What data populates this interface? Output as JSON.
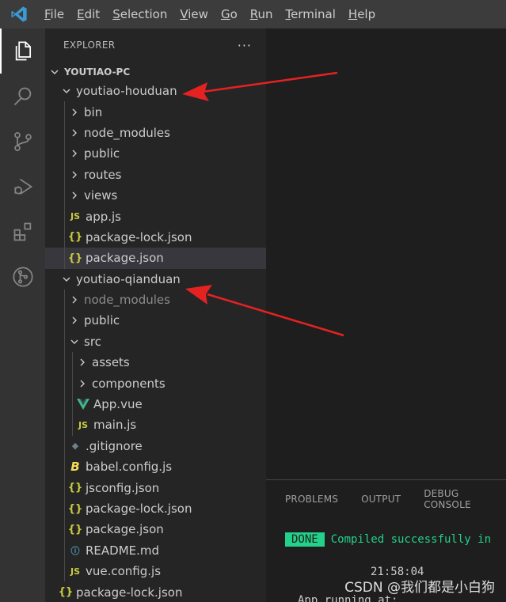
{
  "menu": {
    "items": [
      {
        "label_u": "F",
        "label_rest": "ile"
      },
      {
        "label_u": "E",
        "label_rest": "dit"
      },
      {
        "label_u": "S",
        "label_rest": "election"
      },
      {
        "label_u": "V",
        "label_rest": "iew"
      },
      {
        "label_u": "G",
        "label_rest": "o"
      },
      {
        "label_u": "R",
        "label_rest": "un"
      },
      {
        "label_u": "T",
        "label_rest": "erminal"
      },
      {
        "label_u": "H",
        "label_rest": "elp"
      }
    ]
  },
  "sidebar": {
    "title": "EXPLORER",
    "more": "···",
    "section": "YOUTIAO-PC",
    "tree": [
      {
        "label": "youtiao-houduan",
        "depth": 1,
        "type": "folder-open"
      },
      {
        "label": "bin",
        "depth": 2,
        "type": "folder"
      },
      {
        "label": "node_modules",
        "depth": 2,
        "type": "folder"
      },
      {
        "label": "public",
        "depth": 2,
        "type": "folder"
      },
      {
        "label": "routes",
        "depth": 2,
        "type": "folder"
      },
      {
        "label": "views",
        "depth": 2,
        "type": "folder"
      },
      {
        "label": "app.js",
        "depth": 2,
        "type": "js"
      },
      {
        "label": "package-lock.json",
        "depth": 2,
        "type": "json"
      },
      {
        "label": "package.json",
        "depth": 2,
        "type": "json",
        "selected": true
      },
      {
        "label": "youtiao-qianduan",
        "depth": 1,
        "type": "folder-open"
      },
      {
        "label": "node_modules",
        "depth": 2,
        "type": "folder",
        "dim": true
      },
      {
        "label": "public",
        "depth": 2,
        "type": "folder"
      },
      {
        "label": "src",
        "depth": 2,
        "type": "folder-open"
      },
      {
        "label": "assets",
        "depth": 3,
        "type": "folder"
      },
      {
        "label": "components",
        "depth": 3,
        "type": "folder"
      },
      {
        "label": "App.vue",
        "depth": 3,
        "type": "vue"
      },
      {
        "label": "main.js",
        "depth": 3,
        "type": "js"
      },
      {
        "label": ".gitignore",
        "depth": 2,
        "type": "git"
      },
      {
        "label": "babel.config.js",
        "depth": 2,
        "type": "babel"
      },
      {
        "label": "jsconfig.json",
        "depth": 2,
        "type": "json"
      },
      {
        "label": "package-lock.json",
        "depth": 2,
        "type": "json"
      },
      {
        "label": "package.json",
        "depth": 2,
        "type": "json"
      },
      {
        "label": "README.md",
        "depth": 2,
        "type": "info"
      },
      {
        "label": "vue.config.js",
        "depth": 2,
        "type": "js"
      },
      {
        "label": "package-lock.json",
        "depth": 1,
        "type": "json"
      }
    ]
  },
  "icons": {
    "js": "JS",
    "json": "{}",
    "git": "◆",
    "babel": "B",
    "info": "ⓘ"
  },
  "panel": {
    "tabs": [
      "PROBLEMS",
      "OUTPUT",
      "DEBUG CONSOLE"
    ],
    "done_badge": "DONE",
    "compiled_text": "Compiled successfully in",
    "time": "21:58:04",
    "running_text": "App running at:"
  },
  "watermark": "CSDN @我们都是小白狗",
  "colors": {
    "accent_blue": "#0078d4",
    "arrow_red": "#e52222",
    "done_green": "#23d18b"
  }
}
